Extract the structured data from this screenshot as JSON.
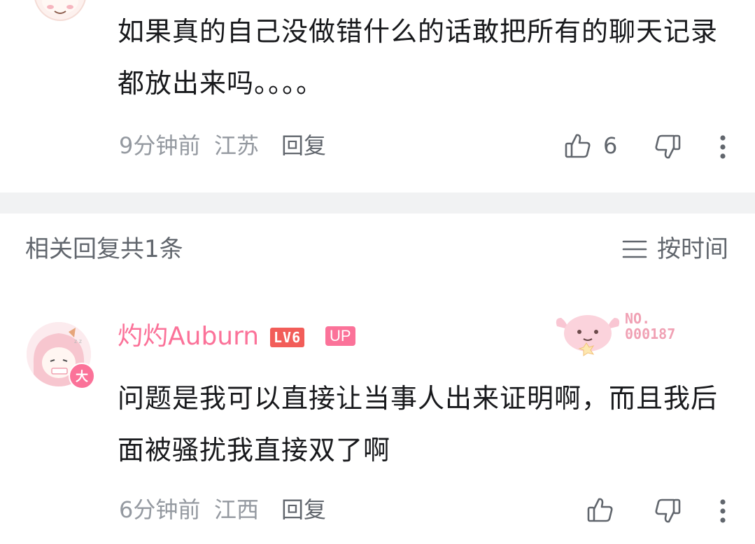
{
  "top_comment": {
    "text": "如果真的自己没做错什么的话敢把所有的聊天记录都放出来吗。。。。",
    "time": "9分钟前",
    "location": "江苏",
    "reply_label": "回复",
    "like_count": "6"
  },
  "related": {
    "header": "相关回复共1条",
    "sort_label": "按时间"
  },
  "reply": {
    "username": "灼灼Auburn",
    "level_badge": "LV6",
    "up_badge": "UP",
    "avatar_badge": "大",
    "fan_label": "NO.",
    "fan_number": "000187",
    "text": "问题是我可以直接让当事人出来证明啊，而且我后面被骚扰我直接双了啊",
    "time": "6分钟前",
    "location": "江西",
    "reply_label": "回复"
  },
  "colors": {
    "accent_pink": "#fb7299",
    "text_primary": "#18191c",
    "text_secondary": "#61666d",
    "text_meta": "#9499a0",
    "divider": "#f1f2f3",
    "level_red": "#f25d59"
  },
  "icons": [
    "thumbs-up-icon",
    "thumbs-down-icon",
    "more-vertical-icon",
    "sort-lines-icon"
  ]
}
